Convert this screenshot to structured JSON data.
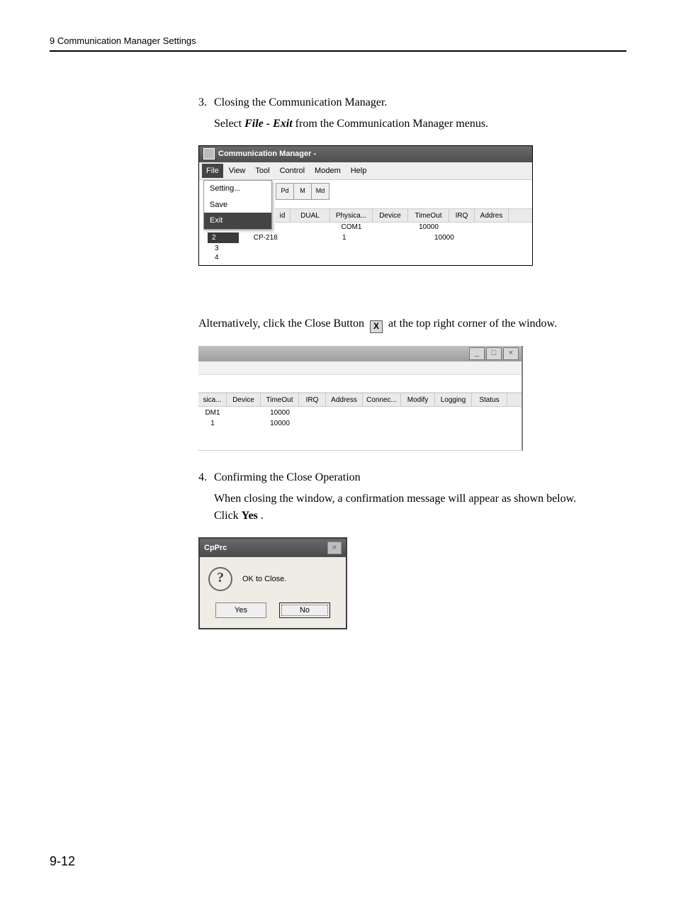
{
  "header": {
    "chapter": "9  Communication Manager Settings"
  },
  "page_number": "9-12",
  "step3": {
    "num": "3.",
    "title": "Closing the Communication Manager.",
    "line_a": "Select ",
    "menu_path": "File - Exit",
    "line_b": " from the Communication Manager menus."
  },
  "fig1": {
    "window_title": "Communication Manager -",
    "menus": {
      "file": "File",
      "view": "View",
      "tool": "Tool",
      "control": "Control",
      "modem": "Modem",
      "help": "Help"
    },
    "file_menu": {
      "setting": "Setting...",
      "save": "Save",
      "exit": "Exit"
    },
    "toolbar": {
      "b1": "Pd",
      "b2": "M",
      "b3": "Md"
    },
    "headers": {
      "id": "id",
      "dual": "DUAL",
      "physica": "Physica...",
      "device": "Device",
      "timeout": "TimeOut",
      "irq": "IRQ",
      "addres": "Addres"
    },
    "row_com": {
      "physica": "COM1",
      "timeout": "10000"
    },
    "row_sel": {
      "n": "2",
      "cp": "CP-218",
      "one": "1",
      "timeout": "10000"
    },
    "nums": {
      "n3": "3",
      "n4": "4"
    }
  },
  "alt_text": {
    "a": "Alternatively, click the Close Button ",
    "b": " at the top right corner of the window."
  },
  "fig2": {
    "btn_min": "_",
    "btn_max": "□",
    "btn_close": "×",
    "headers": {
      "sica": "sica...",
      "device": "Device",
      "timeout": "TimeOut",
      "irq": "IRQ",
      "address": "Address",
      "connec": "Connec...",
      "modify": "Modify",
      "logging": "Logging",
      "status": "Status"
    },
    "r1": {
      "sica": "DM1",
      "timeout": "10000"
    },
    "r2": {
      "sica": "1",
      "timeout": "10000"
    }
  },
  "step4": {
    "num": "4.",
    "title": "Confirming the Close Operation",
    "body_a": "When closing the window, a confirmation message will appear as shown below. Click ",
    "yes": "Yes",
    "body_b": "."
  },
  "dlg": {
    "title": "CpPrc",
    "msg": "OK to Close.",
    "yes": "Yes",
    "no": "No",
    "x": "×",
    "q": "?"
  },
  "close_x_glyph": "X"
}
